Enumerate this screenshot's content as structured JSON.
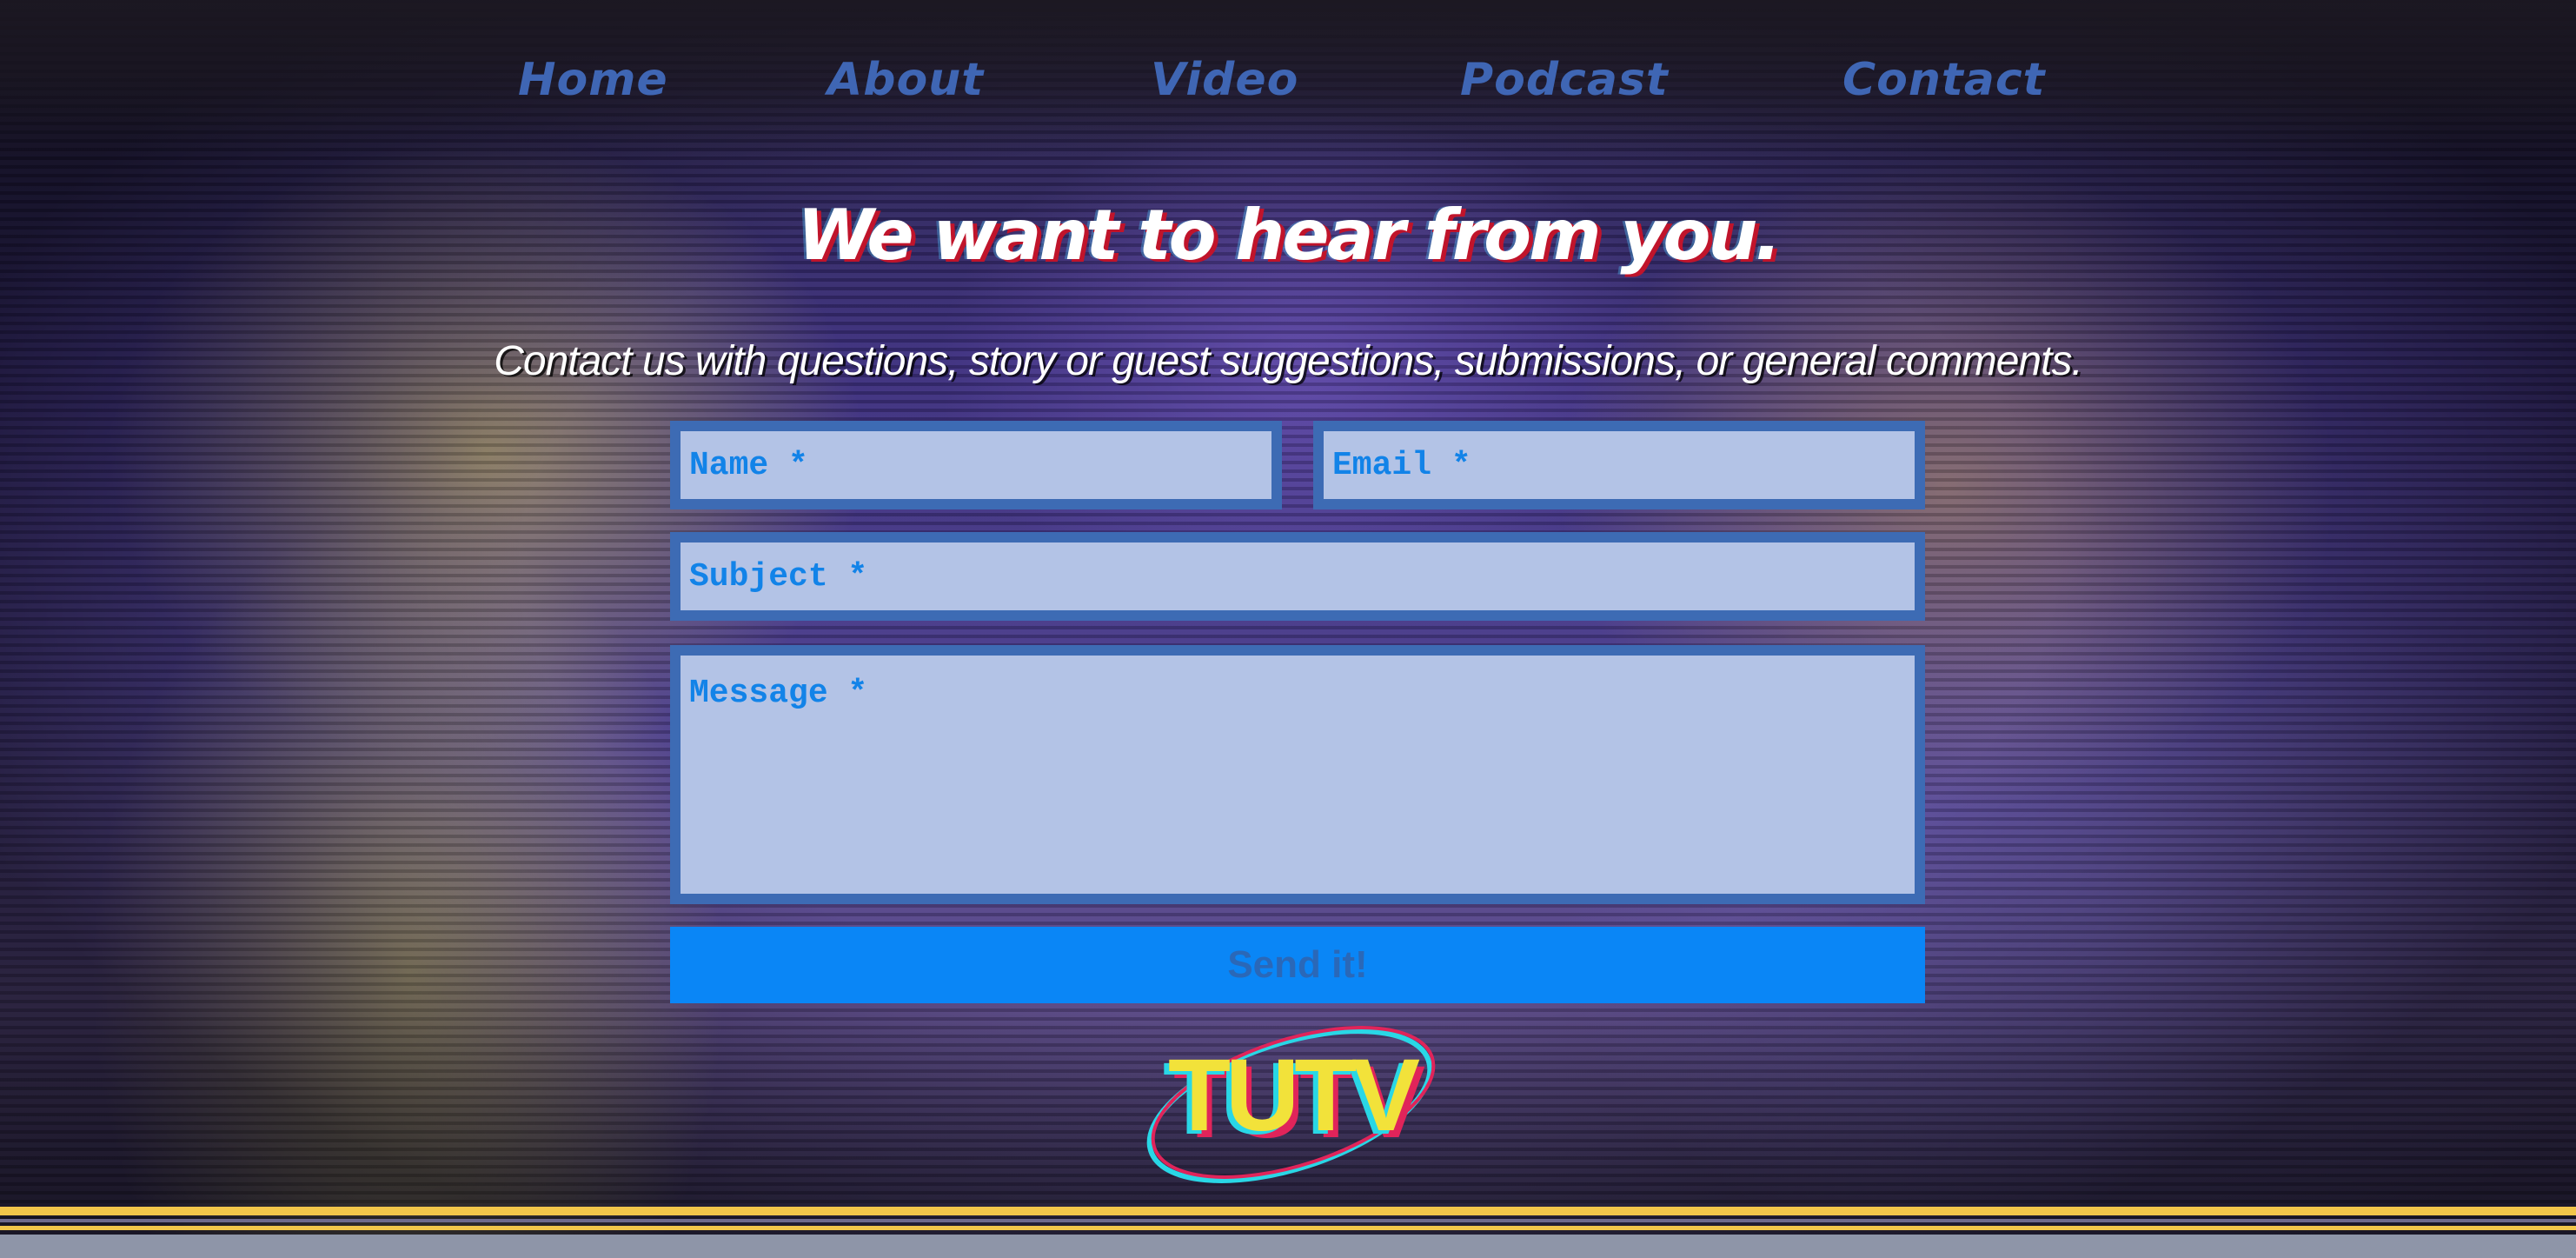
{
  "nav": {
    "items": [
      {
        "label": "Home"
      },
      {
        "label": "About"
      },
      {
        "label": "Video"
      },
      {
        "label": "Podcast"
      },
      {
        "label": "Contact"
      }
    ]
  },
  "hero": {
    "headline": "We want to hear from you.",
    "subheadline": "Contact us with questions, story or guest suggestions, submissions, or general comments."
  },
  "form": {
    "name_placeholder": "Name *",
    "email_placeholder": "Email *",
    "subject_placeholder": "Subject *",
    "message_placeholder": "Message *",
    "submit_label": "Send it!"
  },
  "logo": {
    "text": "TUTV"
  },
  "colors": {
    "nav_text": "#3f66b4",
    "field_bg": "#b3c3e6",
    "field_border": "#3d6bb4",
    "placeholder": "#1283e8",
    "button_bg": "#0a86f6",
    "headline_shadow": "#c0142b",
    "stripe_yellow": "#f2c64a"
  }
}
